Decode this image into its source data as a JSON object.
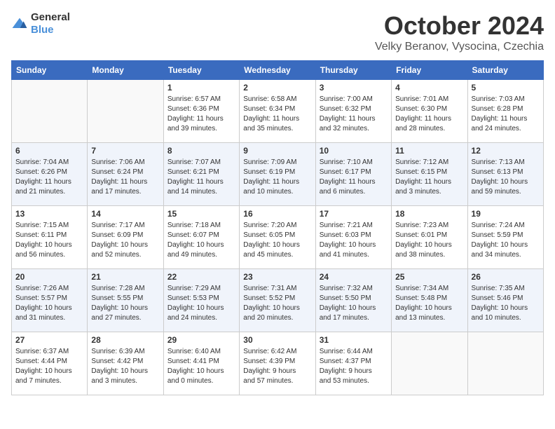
{
  "header": {
    "logo_general": "General",
    "logo_blue": "Blue",
    "month_title": "October 2024",
    "location": "Velky Beranov, Vysocina, Czechia"
  },
  "days_of_week": [
    "Sunday",
    "Monday",
    "Tuesday",
    "Wednesday",
    "Thursday",
    "Friday",
    "Saturday"
  ],
  "weeks": [
    [
      {
        "day": "",
        "content": ""
      },
      {
        "day": "",
        "content": ""
      },
      {
        "day": "1",
        "content": "Sunrise: 6:57 AM\nSunset: 6:36 PM\nDaylight: 11 hours\nand 39 minutes."
      },
      {
        "day": "2",
        "content": "Sunrise: 6:58 AM\nSunset: 6:34 PM\nDaylight: 11 hours\nand 35 minutes."
      },
      {
        "day": "3",
        "content": "Sunrise: 7:00 AM\nSunset: 6:32 PM\nDaylight: 11 hours\nand 32 minutes."
      },
      {
        "day": "4",
        "content": "Sunrise: 7:01 AM\nSunset: 6:30 PM\nDaylight: 11 hours\nand 28 minutes."
      },
      {
        "day": "5",
        "content": "Sunrise: 7:03 AM\nSunset: 6:28 PM\nDaylight: 11 hours\nand 24 minutes."
      }
    ],
    [
      {
        "day": "6",
        "content": "Sunrise: 7:04 AM\nSunset: 6:26 PM\nDaylight: 11 hours\nand 21 minutes."
      },
      {
        "day": "7",
        "content": "Sunrise: 7:06 AM\nSunset: 6:24 PM\nDaylight: 11 hours\nand 17 minutes."
      },
      {
        "day": "8",
        "content": "Sunrise: 7:07 AM\nSunset: 6:21 PM\nDaylight: 11 hours\nand 14 minutes."
      },
      {
        "day": "9",
        "content": "Sunrise: 7:09 AM\nSunset: 6:19 PM\nDaylight: 11 hours\nand 10 minutes."
      },
      {
        "day": "10",
        "content": "Sunrise: 7:10 AM\nSunset: 6:17 PM\nDaylight: 11 hours\nand 6 minutes."
      },
      {
        "day": "11",
        "content": "Sunrise: 7:12 AM\nSunset: 6:15 PM\nDaylight: 11 hours\nand 3 minutes."
      },
      {
        "day": "12",
        "content": "Sunrise: 7:13 AM\nSunset: 6:13 PM\nDaylight: 10 hours\nand 59 minutes."
      }
    ],
    [
      {
        "day": "13",
        "content": "Sunrise: 7:15 AM\nSunset: 6:11 PM\nDaylight: 10 hours\nand 56 minutes."
      },
      {
        "day": "14",
        "content": "Sunrise: 7:17 AM\nSunset: 6:09 PM\nDaylight: 10 hours\nand 52 minutes."
      },
      {
        "day": "15",
        "content": "Sunrise: 7:18 AM\nSunset: 6:07 PM\nDaylight: 10 hours\nand 49 minutes."
      },
      {
        "day": "16",
        "content": "Sunrise: 7:20 AM\nSunset: 6:05 PM\nDaylight: 10 hours\nand 45 minutes."
      },
      {
        "day": "17",
        "content": "Sunrise: 7:21 AM\nSunset: 6:03 PM\nDaylight: 10 hours\nand 41 minutes."
      },
      {
        "day": "18",
        "content": "Sunrise: 7:23 AM\nSunset: 6:01 PM\nDaylight: 10 hours\nand 38 minutes."
      },
      {
        "day": "19",
        "content": "Sunrise: 7:24 AM\nSunset: 5:59 PM\nDaylight: 10 hours\nand 34 minutes."
      }
    ],
    [
      {
        "day": "20",
        "content": "Sunrise: 7:26 AM\nSunset: 5:57 PM\nDaylight: 10 hours\nand 31 minutes."
      },
      {
        "day": "21",
        "content": "Sunrise: 7:28 AM\nSunset: 5:55 PM\nDaylight: 10 hours\nand 27 minutes."
      },
      {
        "day": "22",
        "content": "Sunrise: 7:29 AM\nSunset: 5:53 PM\nDaylight: 10 hours\nand 24 minutes."
      },
      {
        "day": "23",
        "content": "Sunrise: 7:31 AM\nSunset: 5:52 PM\nDaylight: 10 hours\nand 20 minutes."
      },
      {
        "day": "24",
        "content": "Sunrise: 7:32 AM\nSunset: 5:50 PM\nDaylight: 10 hours\nand 17 minutes."
      },
      {
        "day": "25",
        "content": "Sunrise: 7:34 AM\nSunset: 5:48 PM\nDaylight: 10 hours\nand 13 minutes."
      },
      {
        "day": "26",
        "content": "Sunrise: 7:35 AM\nSunset: 5:46 PM\nDaylight: 10 hours\nand 10 minutes."
      }
    ],
    [
      {
        "day": "27",
        "content": "Sunrise: 6:37 AM\nSunset: 4:44 PM\nDaylight: 10 hours\nand 7 minutes."
      },
      {
        "day": "28",
        "content": "Sunrise: 6:39 AM\nSunset: 4:42 PM\nDaylight: 10 hours\nand 3 minutes."
      },
      {
        "day": "29",
        "content": "Sunrise: 6:40 AM\nSunset: 4:41 PM\nDaylight: 10 hours\nand 0 minutes."
      },
      {
        "day": "30",
        "content": "Sunrise: 6:42 AM\nSunset: 4:39 PM\nDaylight: 9 hours\nand 57 minutes."
      },
      {
        "day": "31",
        "content": "Sunrise: 6:44 AM\nSunset: 4:37 PM\nDaylight: 9 hours\nand 53 minutes."
      },
      {
        "day": "",
        "content": ""
      },
      {
        "day": "",
        "content": ""
      }
    ]
  ]
}
